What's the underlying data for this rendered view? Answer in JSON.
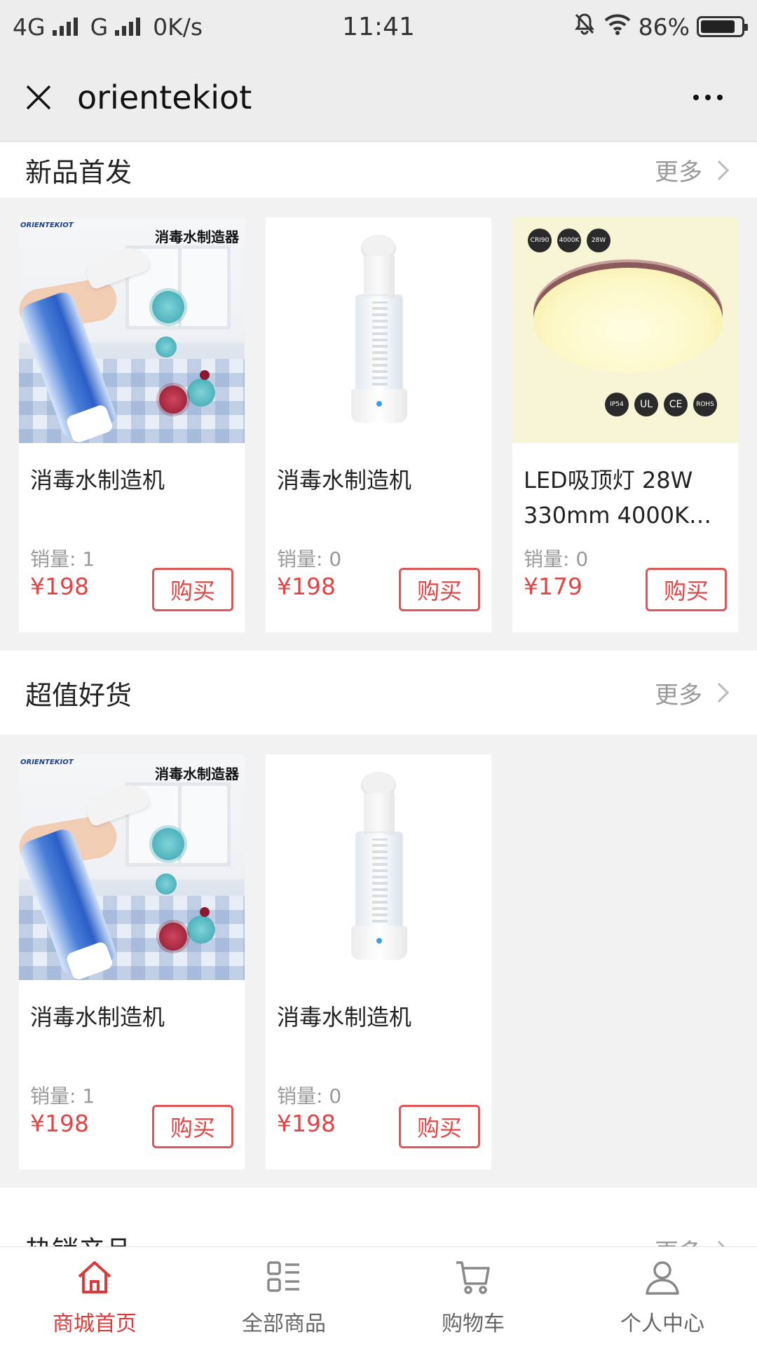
{
  "status_bar": {
    "network1": "4G",
    "network2": "G",
    "speed": "0K/s",
    "time": "11:41",
    "battery": "86%",
    "battery_level": 0.86
  },
  "title_bar": {
    "title": "orientekiot"
  },
  "sections": [
    {
      "title": "新品首发",
      "more": "更多",
      "products": [
        {
          "name": "消毒水制造机",
          "sales": "销量: 1",
          "price": "¥198",
          "buy": "购买",
          "image_logo": "ORIENTEKIOT",
          "image_tag": "消毒水制造器"
        },
        {
          "name": "消毒水制造机",
          "sales": "销量: 0",
          "price": "¥198",
          "buy": "购买"
        },
        {
          "name": "LED吸顶灯 28W 330mm 4000K…",
          "sales": "销量: 0",
          "price": "¥179",
          "buy": "购买",
          "image_badges": [
            "CRI90",
            "4000K",
            "28W"
          ],
          "image_certs": [
            "IP54",
            "UL",
            "CE",
            "ROHS"
          ]
        }
      ]
    },
    {
      "title": "超值好货",
      "more": "更多",
      "products": [
        {
          "name": "消毒水制造机",
          "sales": "销量: 1",
          "price": "¥198",
          "buy": "购买",
          "image_logo": "ORIENTEKIOT",
          "image_tag": "消毒水制造器"
        },
        {
          "name": "消毒水制造机",
          "sales": "销量: 0",
          "price": "¥198",
          "buy": "购买"
        }
      ]
    },
    {
      "title": "热销产品",
      "more": "更多"
    }
  ],
  "bottom_nav": [
    {
      "label": "商城首页",
      "icon": "home-icon",
      "active": true
    },
    {
      "label": "全部商品",
      "icon": "list-icon",
      "active": false
    },
    {
      "label": "购物车",
      "icon": "cart-icon",
      "active": false
    },
    {
      "label": "个人中心",
      "icon": "user-icon",
      "active": false
    }
  ],
  "colors": {
    "accent": "#e04545",
    "nav_active": "#d93a3a",
    "muted": "#999999"
  }
}
